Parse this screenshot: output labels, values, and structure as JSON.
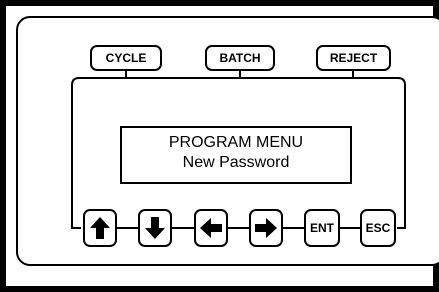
{
  "status_keys": {
    "cycle": "CYCLE",
    "batch": "BATCH",
    "reject": "REJECT"
  },
  "display": {
    "line1": "PROGRAM MENU",
    "line2": "New Password"
  },
  "keypad": {
    "up_icon": "arrow-up-icon",
    "down_icon": "arrow-down-icon",
    "left_icon": "arrow-left-icon",
    "right_icon": "arrow-right-icon",
    "enter_label": "ENT",
    "escape_label": "ESC"
  },
  "colors": {
    "line": "#000000",
    "background": "#ffffff"
  }
}
